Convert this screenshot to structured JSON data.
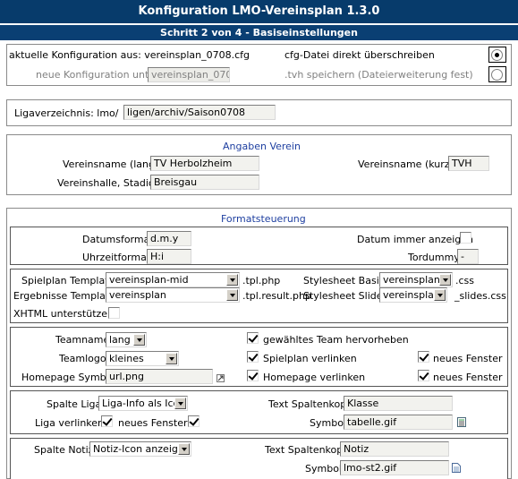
{
  "window": {
    "title": "Konfiguration LMO-Vereinsplan 1.3.0",
    "step": "Schritt 2 von 4 - Basiseinstellungen"
  },
  "config": {
    "current_label": "aktuelle Konfiguration aus: vereinsplan_0708.cfg",
    "overwrite_label": "cfg-Datei direkt überschreiben",
    "new_label": "neue Konfiguration unter:",
    "new_value": "vereinsplan_0708",
    "tvh_label": ".tvh speichern (Dateierweiterung fest)",
    "overwrite_selected": true
  },
  "liga": {
    "label": "Ligaverzeichnis: lmo/",
    "value": "ligen/archiv/Saison0708"
  },
  "verein": {
    "header": "Angaben Verein",
    "name_long_label": "Vereinsname (lang)",
    "name_long_value": "TV Herbolzheim",
    "name_short_label": "Vereinsname (kurz)",
    "name_short_value": "TVH",
    "hall_label": "Vereinshalle, Stadion",
    "hall_value": "Breisgau"
  },
  "format": {
    "header": "Formatsteuerung",
    "date_label": "Datumsformat",
    "date_value": "d.m.y",
    "time_label": "Uhrzeitformat",
    "time_value": "H:i",
    "date_always_label": "Datum immer anzeigen",
    "date_always_checked": false,
    "tordummy_label": "Tordummy",
    "tordummy_value": "-"
  },
  "templates": {
    "spielplan_label": "Spielplan Template",
    "spielplan_value": "vereinsplan-mid",
    "spielplan_ext": ".tpl.php",
    "result_label": "Ergebnisse Template",
    "result_value": "vereinsplan",
    "result_ext": ".tpl.result.php",
    "css_label": "Stylesheet Basis",
    "css_value": "vereinsplan",
    "css_ext": ".css",
    "slider_label": "Stylesheet Slider",
    "slider_value": "vereinsplan",
    "slider_ext": "_slides.css",
    "xhtml_label": "XHTML unterstützen",
    "xhtml_checked": false
  },
  "team": {
    "name_label": "Teamname",
    "name_value": "lang",
    "logo_label": "Teamlogo",
    "logo_value": "kleines",
    "homepage_label": "Homepage Symbol",
    "homepage_value": "url.png",
    "highlight_label": "gewähltes Team hervorheben",
    "highlight_checked": true,
    "link_plan_label": "Spielplan verlinken",
    "link_plan_checked": true,
    "link_plan_new_label": "neues Fenster",
    "link_plan_new_checked": true,
    "link_home_label": "Homepage verlinken",
    "link_home_checked": true,
    "link_home_new_label": "neues Fenster",
    "link_home_new_checked": true
  },
  "spalte_liga": {
    "label": "Spalte Liga",
    "value": "Liga-Info als Icon",
    "link_label": "Liga verlinken",
    "link_checked": true,
    "new_window_label": "neues Fenster",
    "new_window_checked": true,
    "header_label": "Text Spaltenkopf",
    "header_value": "Klasse",
    "symbol_label": "Symbol",
    "symbol_value": "tabelle.gif"
  },
  "spalte_notiz": {
    "label": "Spalte Notiz",
    "value": "Notiz-Icon anzeigen",
    "header_label": "Text Spaltenkopf",
    "header_value": "Notiz",
    "symbol_label": "Symbol",
    "symbol_value": "lmo-st2.gif"
  }
}
